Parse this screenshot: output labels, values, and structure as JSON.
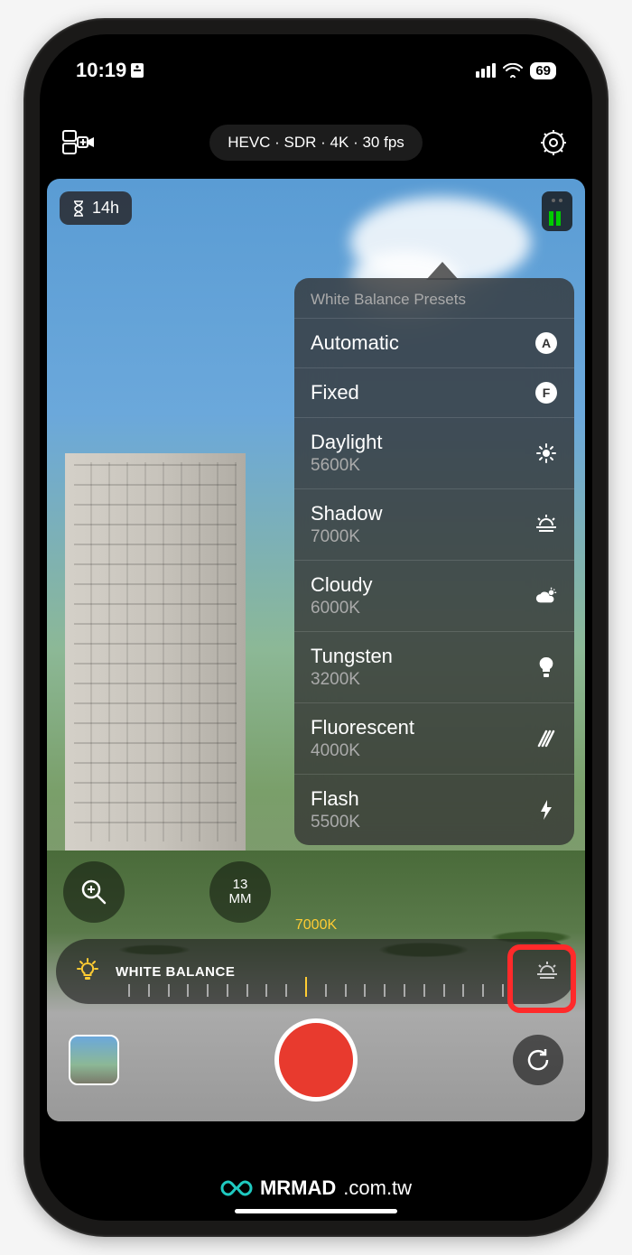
{
  "status": {
    "time": "10:19",
    "battery": "69"
  },
  "topbar": {
    "format": "HEVC · SDR · 4K · 30 fps"
  },
  "badges": {
    "time_remaining": "14h",
    "focal_number": "13",
    "focal_unit": "MM"
  },
  "presets": {
    "title": "White Balance Presets",
    "items": [
      {
        "label": "Automatic",
        "sub": "",
        "badge": "A",
        "icon": "auto"
      },
      {
        "label": "Fixed",
        "sub": "",
        "badge": "F",
        "icon": "fixed"
      },
      {
        "label": "Daylight",
        "sub": "5600K",
        "icon": "sun"
      },
      {
        "label": "Shadow",
        "sub": "7000K",
        "icon": "sunrise"
      },
      {
        "label": "Cloudy",
        "sub": "6000K",
        "icon": "cloud"
      },
      {
        "label": "Tungsten",
        "sub": "3200K",
        "icon": "bulb"
      },
      {
        "label": "Fluorescent",
        "sub": "4000K",
        "icon": "fluorescent"
      },
      {
        "label": "Flash",
        "sub": "5500K",
        "icon": "flash"
      }
    ]
  },
  "wb": {
    "label": "WHITE BALANCE",
    "value": "7000K"
  },
  "watermark": {
    "brand_bold": "MRMAD",
    "brand_thin": ".com.tw"
  }
}
